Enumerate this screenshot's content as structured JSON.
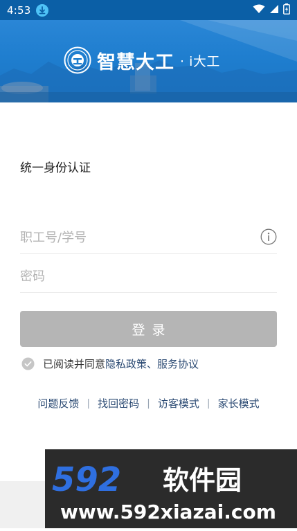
{
  "status_bar": {
    "time": "4:53",
    "icons": [
      "download-icon",
      "wifi-icon",
      "signal-icon",
      "battery-icon"
    ]
  },
  "header": {
    "title": "智慧大工",
    "subtitle": "· i大工"
  },
  "form": {
    "heading": "统一身份认证",
    "username_placeholder": "职工号/学号",
    "username_value": "",
    "password_placeholder": "密码",
    "password_value": "",
    "login_label": "登录"
  },
  "agreement": {
    "prefix": "已阅读并同意",
    "privacy": "隐私政策",
    "separator": "、",
    "terms": "服务协议"
  },
  "links": {
    "feedback": "问题反馈",
    "recover": "找回密码",
    "visitor": "访客模式",
    "parent": "家长模式",
    "divider": "|"
  },
  "colors": {
    "header_blue": "#1f7ecf",
    "status_blue": "#0b5fa6",
    "button_disabled": "#b5b5b5",
    "link": "#2b4a73"
  }
}
